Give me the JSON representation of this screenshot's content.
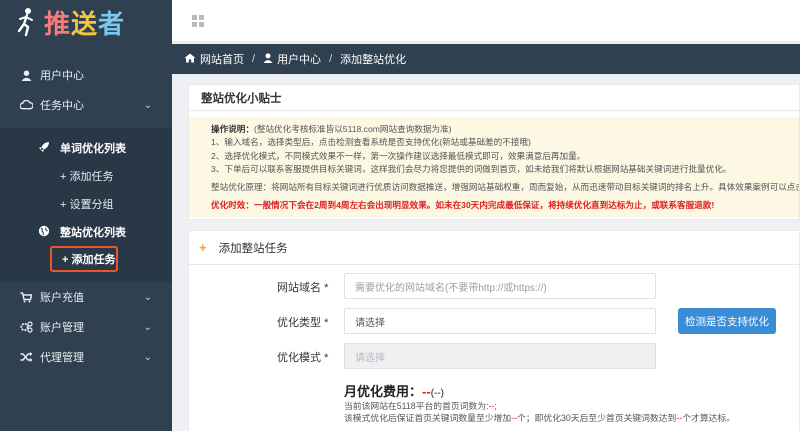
{
  "brand": {
    "logo_c1": "推",
    "logo_c2": "送",
    "logo_c3": "者"
  },
  "sidebar": {
    "user_center": "用户中心",
    "task_center": "任务中心",
    "word_list": "单词优化列表",
    "add_task_1": "+ 添加任务",
    "set_group": "+ 设置分组",
    "site_list": "整站优化列表",
    "add_task_2": "+ 添加任务",
    "account_recharge": "账户充值",
    "account_manage": "账户管理",
    "agent_manage": "代理管理"
  },
  "breadcrumb": {
    "home": "网站首页",
    "user_center": "用户中心",
    "current": "添加整站优化"
  },
  "tips": {
    "title": "整站优化小贴士",
    "op_label": "操作说明：",
    "op_text": "(整站优化考核标准皆以5118.com网站查询数据为准)",
    "line1": "1、输入域名，选择类型后，点击检测查看系统是否支持优化(新站或基础差的不接哦)",
    "line2": "2、选择优化模式，不同模式效果不一样，第一次操作建议选择最低模式即可，效果满意后再加量。",
    "line3": "3、下单后可以联系客服提供目标关键词，这样我们会尽力将您提供的词做到首页，如未给我们将默认根据网站基础关键词进行批量优化。",
    "principle": "整站优化原理：将网站所有目标关键词进行优质访问数据推送，增强网站基础权重，周而复始，从而迅速带动目标关键词的排名上升。具体效果案例可以点击",
    "timing": "优化时效：一般情况下会在2周到4周左右会出现明显效果。如未在30天内完成最低保证，将持续优化直到达标为止，或联系客服退款!"
  },
  "form": {
    "title": "添加整站任务",
    "domain_label": "网站域名",
    "domain_placeholder": "需要优化的网站域名(不要带http://或https://)",
    "type_label": "优化类型",
    "type_value": "请选择",
    "check_button": "检测是否支持优化",
    "mode_label": "优化模式",
    "mode_value": "请选择",
    "required_mark": "*",
    "fee_label": "月优化费用：",
    "fee_value": "--",
    "fee_paren": "(--)",
    "count_line_a": "当前该网站在5118平台的首页词数为:",
    "count_val": "--",
    "count_line_b": ";",
    "guarantee_a": "该模式优化后保证首页关键词数量至少增加",
    "g_val1": "--",
    "guarantee_b": "个；即优化30天后至少首页关键词数达到",
    "g_val2": "--",
    "guarantee_c": "个才算达标。"
  },
  "colors": {
    "sidebar_bg": "#2f4050",
    "accent_blue": "#3b8cd6",
    "warning_bg": "#fcf8e3",
    "highlight": "#e8562a",
    "danger": "#e02020"
  }
}
